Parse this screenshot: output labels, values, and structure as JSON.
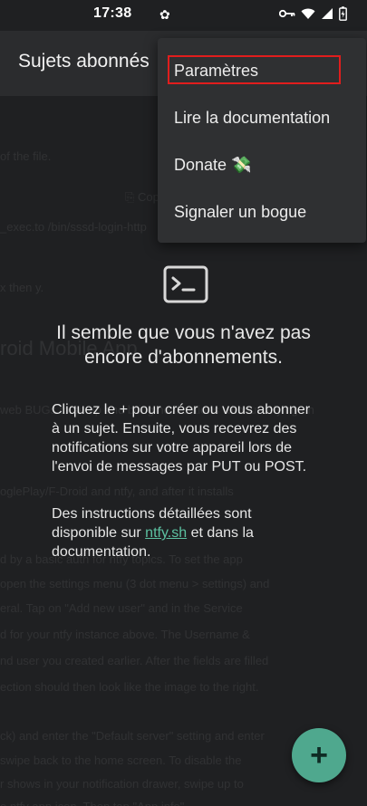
{
  "status_bar": {
    "time": "17:38",
    "notif_glyph": "✿",
    "icons": [
      "key-icon",
      "wifi-icon",
      "signal-icon",
      "battery-icon"
    ]
  },
  "app_bar": {
    "title": "Sujets abonnés"
  },
  "menu": {
    "items": [
      "Paramètres",
      "Lire la documentation",
      "Donate 💸",
      "Signaler un bogue"
    ]
  },
  "empty_state": {
    "headline": "Il semble que vous n'avez pas encore d'abonnements.",
    "paragraph1": "Cliquez le + pour créer ou vous abonner à un sujet. Ensuite, vous recevrez des notifications sur votre appareil lors de l'envoi de messages par PUT ou POST.",
    "paragraph2_before": "Des instructions détaillées sont disponible sur ",
    "paragraph2_link": "ntfy.sh",
    "paragraph2_after": " et dans la documentation."
  },
  "fab": {
    "label": "+"
  },
  "colors": {
    "background": "#1f2022",
    "accent": "#4fa88e",
    "link": "#5cc1a1",
    "highlight_box": "#e11d1d"
  }
}
